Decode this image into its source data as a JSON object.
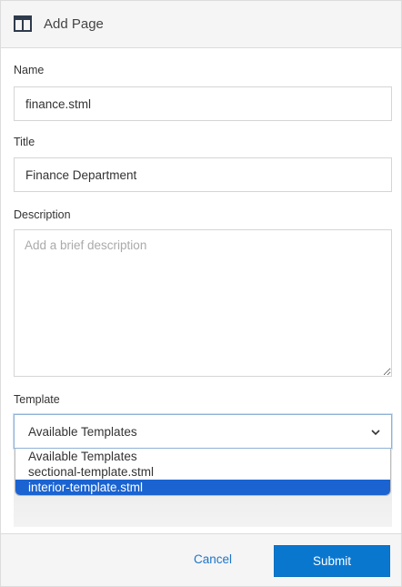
{
  "dialog": {
    "title": "Add Page",
    "header_icon": "layout-columns-icon"
  },
  "form": {
    "name": {
      "label": "Name",
      "value": "finance.stml"
    },
    "title": {
      "label": "Title",
      "value": "Finance Department"
    },
    "description": {
      "label": "Description",
      "value": "",
      "placeholder": "Add a brief description"
    },
    "template": {
      "label": "Template",
      "selected": "Available Templates",
      "chevron_icon": "chevron-down-icon",
      "options": [
        "Available Templates",
        "sectional-template.stml",
        "interior-template.stml"
      ],
      "highlighted_option": "interior-template.stml"
    }
  },
  "footer": {
    "cancel_label": "Cancel",
    "submit_label": "Submit"
  },
  "colors": {
    "accent": "#0a77cf",
    "link": "#1d75c9",
    "highlight": "#1a63d1",
    "header_bg": "#f5f5f5"
  }
}
